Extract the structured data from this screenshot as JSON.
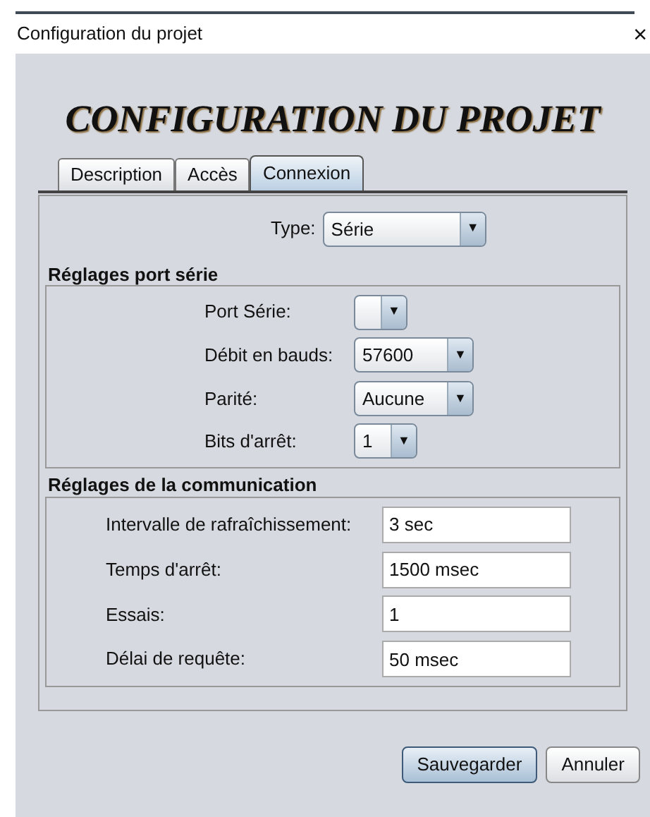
{
  "window": {
    "title": "Configuration du projet",
    "close": "×"
  },
  "heading": "CONFIGURATION DU PROJET",
  "tabs": [
    {
      "label": "Description",
      "selected": false
    },
    {
      "label": "Accès",
      "selected": false
    },
    {
      "label": "Connexion",
      "selected": true
    }
  ],
  "type_field": {
    "label": "Type:",
    "value": "Série",
    "arrow": "▼"
  },
  "serial_section": {
    "title": "Réglages port série",
    "rows": [
      {
        "label": "Port Série:",
        "value": "",
        "arrow": "▼"
      },
      {
        "label": "Débit en bauds:",
        "value": "57600",
        "arrow": "▼"
      },
      {
        "label": "Parité:",
        "value": "Aucune",
        "arrow": "▼"
      },
      {
        "label": "Bits d'arrêt:",
        "value": "1",
        "arrow": "▼"
      }
    ]
  },
  "comm_section": {
    "title": "Réglages de la communication",
    "rows": [
      {
        "label": "Intervalle de rafraîchissement:",
        "value": "3 sec"
      },
      {
        "label": "Temps d'arrêt:",
        "value": "1500 msec"
      },
      {
        "label": "Essais:",
        "value": "1"
      },
      {
        "label": "Délai de requête:",
        "value": "50 msec"
      }
    ]
  },
  "buttons": [
    {
      "label": "Sauvegarder",
      "kind": "primary"
    },
    {
      "label": "Annuler",
      "kind": "secondary"
    }
  ]
}
